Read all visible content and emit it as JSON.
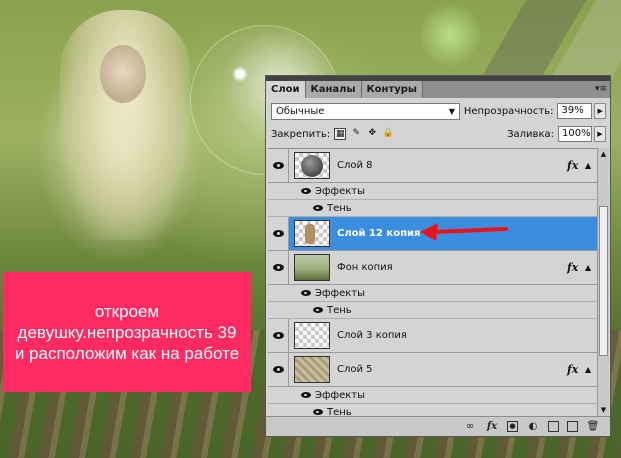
{
  "caption": {
    "text": "откроем девушку.непрозрачность 39 и расположим как на работе"
  },
  "panel": {
    "tabs": [
      {
        "label": "Слои",
        "active": true
      },
      {
        "label": "Каналы",
        "active": false
      },
      {
        "label": "Контуры",
        "active": false
      }
    ],
    "blend_mode": "Обычные",
    "opacity_label": "Непрозрачность:",
    "opacity_value": "39%",
    "lock_label": "Закрепить:",
    "fill_label": "Заливка:",
    "fill_value": "100%",
    "layers": [
      {
        "name": "Слой 8",
        "thumb": "ball-icon",
        "fx": "fx",
        "effects_label": "Эффекты",
        "effect": "Тень"
      },
      {
        "name": "Слой 12 копия",
        "thumb": "girl",
        "selected": true
      },
      {
        "name": "Фон копия",
        "thumb": "landscape",
        "fx": "fx",
        "effects_label": "Эффекты",
        "effect": "Тень"
      },
      {
        "name": "Слой 3 копия",
        "thumb": "transparent"
      },
      {
        "name": "Слой 5",
        "thumb": "pattern",
        "fx": "fx",
        "effects_label": "Эффекты",
        "effect": "Тень"
      }
    ],
    "bottom_tools": [
      "link-icon",
      "fx-icon",
      "mask-icon",
      "adjustment-icon",
      "group-folder-icon",
      "new-layer-icon",
      "trash-icon"
    ],
    "bottom_fx": "fx"
  },
  "colors": {
    "caption_bg": "#ff2a62",
    "selection": "#3b8de0",
    "arrow": "#e8141c"
  }
}
